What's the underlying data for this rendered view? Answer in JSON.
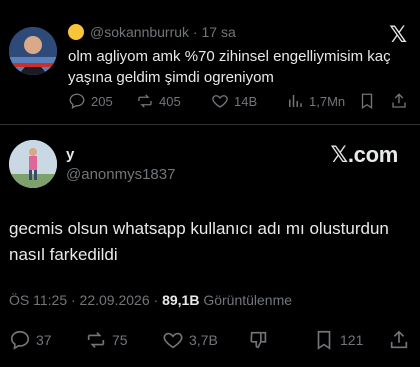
{
  "quoted": {
    "handle": "@sokannburruk",
    "time": "17 sa",
    "text": "olm agliyom amk %70 zihinsel engelliymisim kaç yaşına geldim şimdi ogreniyom",
    "replies": "205",
    "reposts": "405",
    "likes": "14B",
    "views": "1,7Mn",
    "logo": "𝕏"
  },
  "author": {
    "name": "y",
    "handle": "@anonmys1837"
  },
  "watermark": "𝕏.com",
  "tweet": {
    "text": "gecmis olsun whatsapp kullanıcı adı mı olusturdun nasıl farkedildi"
  },
  "meta": {
    "time": "ÖS 11:25 · 22.09.2026 · ",
    "views": "89,1B",
    "views_label": " Görüntülenme"
  },
  "actions": {
    "replies": "37",
    "reposts": "75",
    "likes": "3,7B",
    "bookmarks": "121"
  },
  "colors": {
    "background": "#000000",
    "text": "#e7e9ea",
    "muted": "#71767b",
    "divider": "#2f3336"
  }
}
